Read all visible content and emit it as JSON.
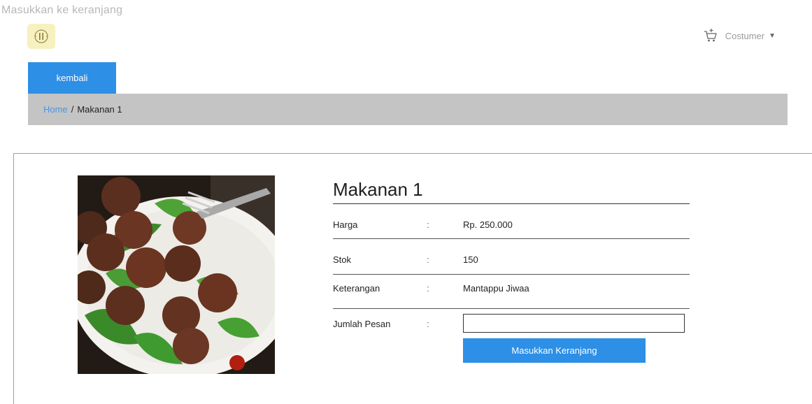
{
  "page": {
    "caption": "Masukkan ke keranjang"
  },
  "header": {
    "user_label": "Costumer",
    "icons": {
      "logo": "logo-emblem",
      "cart": "cart-icon",
      "caret": "caret-down-icon"
    }
  },
  "nav": {
    "back_label": "kembali"
  },
  "breadcrumb": {
    "home": "Home",
    "separator": "/",
    "current": "Makanan 1"
  },
  "product": {
    "title": "Makanan 1",
    "fields": [
      {
        "label": "Harga",
        "colon": ":",
        "value": "Rp. 250.000"
      },
      {
        "label": "Stok",
        "colon": ":",
        "value": "150"
      },
      {
        "label": "Keterangan",
        "colon": ":",
        "value": "Mantappu Jiwaa"
      }
    ],
    "quantity": {
      "label": "Jumlah Pesan",
      "colon": ":",
      "value": ""
    },
    "add_button_label": "Masukkan Keranjang",
    "image_icon": "meatball-salad-photo"
  },
  "colors": {
    "accent": "#2d8fe6",
    "breadcrumb_bg": "#c4c4c4",
    "link": "#4a93e3"
  }
}
